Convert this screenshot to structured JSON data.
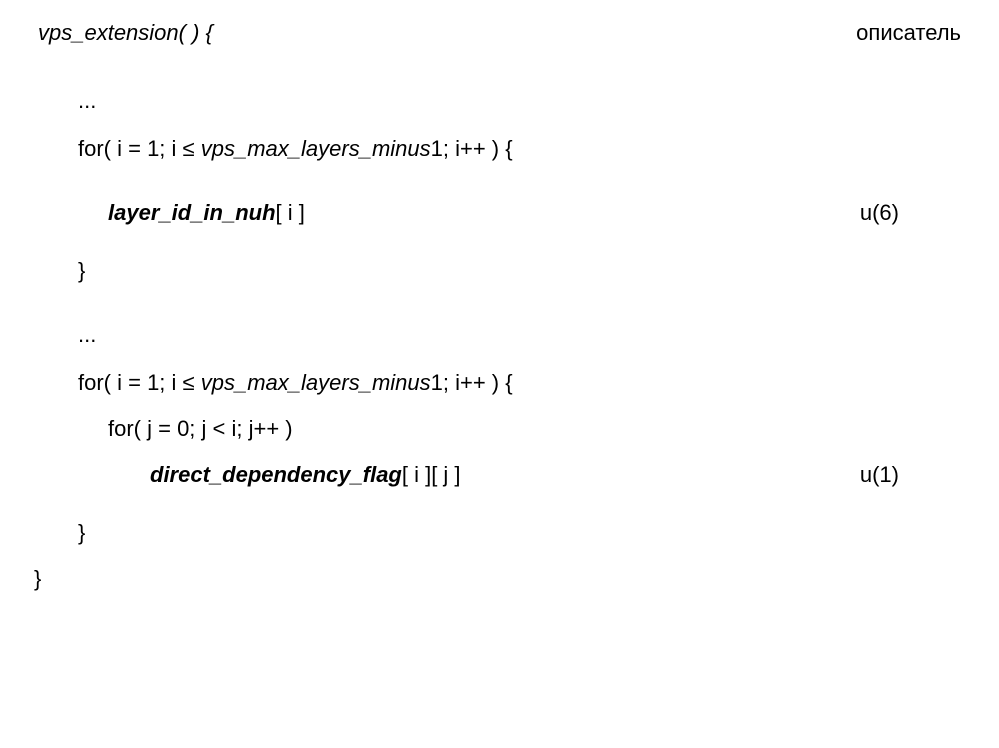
{
  "header": {
    "function_signature": "vps_extension( ) {",
    "descriptor_label": "описатель"
  },
  "lines": {
    "ellipsis1": "...",
    "for1_prefix": "for( i = 1; i ",
    "for1_var": "vps_max_layers_minus",
    "for1_suffix": "1; i++ ) {",
    "layer_id": "layer_id_in_nuh",
    "layer_id_suffix": "[ i ]",
    "desc_u6": "u(6)",
    "close_brace1": "}",
    "ellipsis2": "...",
    "for2_prefix": "for( i = 1; i ",
    "for2_var": "vps_max_layers_minus",
    "for2_suffix": "1; i++ ) {",
    "for_j": "for( j = 0; j < i; j++ )",
    "direct_dep": "direct_dependency_flag",
    "direct_dep_suffix": "[ i ][ j ]",
    "desc_u1": "u(1)",
    "close_brace2": "}",
    "close_brace_final": "}",
    "lte": "≤"
  }
}
